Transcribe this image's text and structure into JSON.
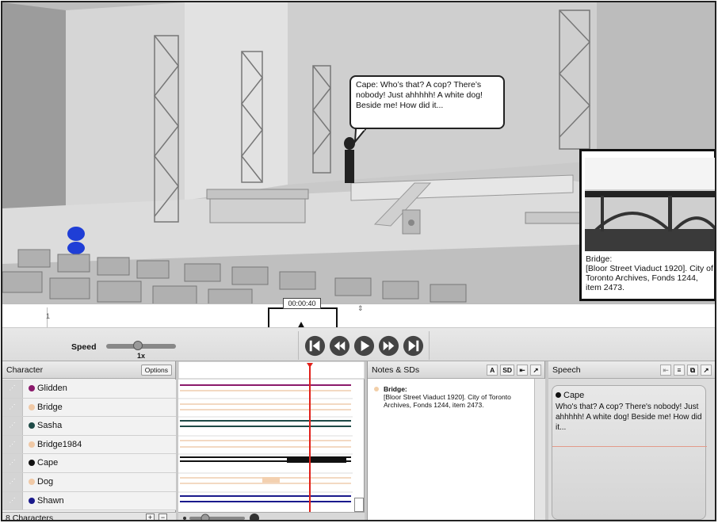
{
  "viewport": {
    "speech_bubble": "Cape: Who’s that? A cop? There’s nobody! Just ahhhhh! A white dog! Beside me! How did it...",
    "image_caption": "Bridge:\n[Bloor Street Viaduct 1920]. City of Toronto Archives, Fonds 1244, item 2473."
  },
  "timeline": {
    "line_number": "1",
    "current_time": "00:00:40"
  },
  "controls": {
    "speed_label": "Speed",
    "speed_value": "1x",
    "speed_level": 0.45,
    "buttons": [
      "skip-back-icon",
      "rewind-icon",
      "play-icon",
      "fast-forward-icon",
      "skip-forward-icon"
    ]
  },
  "characters": {
    "title": "Character",
    "options_label": "Options",
    "items": [
      {
        "name": "Glidden",
        "color": "#8b1a6b"
      },
      {
        "name": "Bridge",
        "color": "#f0c9a6"
      },
      {
        "name": "Sasha",
        "color": "#1e4a47"
      },
      {
        "name": "Bridge1984",
        "color": "#f0c9a6"
      },
      {
        "name": "Cape",
        "color": "#111111"
      },
      {
        "name": "Dog",
        "color": "#f0c9a6"
      },
      {
        "name": "Shawn",
        "color": "#1a1a8c"
      }
    ],
    "count_label": "8 Characters",
    "add_label": "+",
    "remove_label": "−"
  },
  "notes": {
    "title": "Notes & SDs",
    "btn_a": "A",
    "btn_sd": "SD",
    "entry_title": "Bridge:",
    "entry_text": "[Bloor Street Viaduct 1920]. City of Toronto Archives, Fonds 1244, item 2473."
  },
  "speech": {
    "title": "Speech",
    "speaker": "Cape",
    "text": "Who's that? A cop? There's nobody! Just ahhhhh! A white dog! Beside me! How did it..."
  },
  "colors": {
    "playhead": "#e0201a",
    "accent_track": "#8b1a6b"
  }
}
